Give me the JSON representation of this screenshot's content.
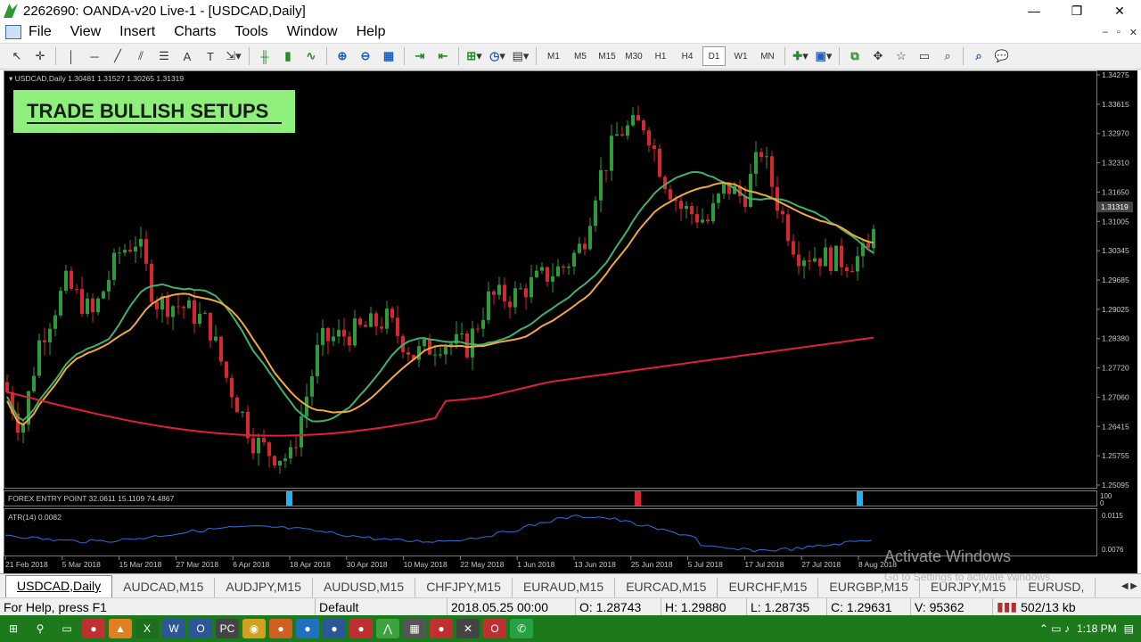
{
  "window": {
    "title": "2262690: OANDA-v20 Live-1 - [USDCAD,Daily]",
    "min_glyph": "—",
    "max_glyph": "❐",
    "close_glyph": "✕"
  },
  "menu": [
    "File",
    "View",
    "Insert",
    "Charts",
    "Tools",
    "Window",
    "Help"
  ],
  "mdi_controls": [
    "–",
    "▫",
    "✕"
  ],
  "toolbar": {
    "timeframes": [
      "M1",
      "M5",
      "M15",
      "M30",
      "H1",
      "H4",
      "D1",
      "W1",
      "MN"
    ],
    "selected_timeframe": "D1"
  },
  "chart": {
    "symbol_info": "USDCAD,Daily  1.30481 1.31527 1.30265 1.31319",
    "banner": "TRADE BULLISH SETUPS",
    "current_price": "1.31319",
    "price_labels": [
      "1.34275",
      "1.33615",
      "1.32970",
      "1.32310",
      "1.31650",
      "1.31005",
      "1.30345",
      "1.29685",
      "1.29025",
      "1.28380",
      "1.27720",
      "1.27060",
      "1.26415",
      "1.25755",
      "1.25095"
    ],
    "date_labels": [
      "21 Feb 2018",
      "5 Mar 2018",
      "15 Mar 2018",
      "27 Mar 2018",
      "6 Apr 2018",
      "18 Apr 2018",
      "30 Apr 2018",
      "10 May 2018",
      "22 May 2018",
      "1 Jun 2018",
      "13 Jun 2018",
      "25 Jun 2018",
      "5 Jul 2018",
      "17 Jul 2018",
      "27 Jul 2018",
      "8 Aug 2018"
    ],
    "indicator1": {
      "label": "FOREX ENTRY POINT 32.0611 15.1109 74.4867",
      "scale_top": "100",
      "scale_bottom": "0"
    },
    "indicator2": {
      "label": "ATR(14) 0.0082",
      "scale_top": "0.0115",
      "scale_bottom": "0.0076"
    },
    "colors": {
      "bull": "#2e9b3a",
      "bear": "#d62630",
      "ma_fast": "#3fb26a",
      "ma_mid": "#f2a93b",
      "ma_slow": "#e0203a",
      "atr": "#2d6fe0",
      "signal_blue": "#1eb4f0",
      "signal_red": "#d62630",
      "banner_bg": "#8ef07a"
    }
  },
  "tabs": [
    "USDCAD,Daily",
    "AUDCAD,M15",
    "AUDJPY,M15",
    "AUDUSD,M15",
    "CHFJPY,M15",
    "EURAUD,M15",
    "EURCAD,M15",
    "EURCHF,M15",
    "EURGBP,M15",
    "EURJPY,M15",
    "EURUSD,"
  ],
  "active_tab": "USDCAD,Daily",
  "status": {
    "help": "For Help, press F1",
    "profile": "Default",
    "datetime": "2018.05.25 00:00",
    "open": "O: 1.28743",
    "high": "H: 1.29880",
    "low": "L: 1.28735",
    "close": "C: 1.29631",
    "volume": "V: 95362",
    "traffic": "502/13 kb"
  },
  "watermark": {
    "line1": "Activate Windows",
    "line2": "Go to Settings to activate Windows."
  },
  "taskbar": {
    "time": "1:18 PM"
  }
}
